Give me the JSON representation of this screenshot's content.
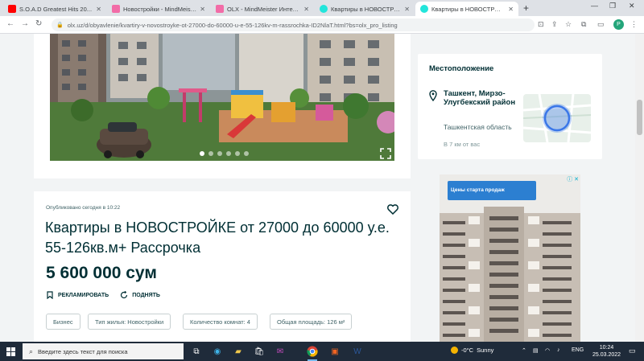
{
  "browser": {
    "tabs": [
      {
        "favicon": "youtube-icon",
        "title": "S.O.A.D Greatest Hits 20..."
      },
      {
        "favicon": "mindmeister-icon",
        "title": "Новостройки - MindMeister"
      },
      {
        "favicon": "mindmeister-icon",
        "title": "OLX - MindMeister Интелле..."
      },
      {
        "favicon": "olx-icon",
        "title": "Квартиры в НОВОСТРОЙКЕ..."
      },
      {
        "favicon": "olx-icon",
        "title": "Квартиры в НОВОСТРОЙКЕ..."
      }
    ],
    "active_tab": 4,
    "new_tab_label": "+",
    "url": "olx.uz/d/obyavlenie/kvartiry-v-novostroyke-ot-27000-do-60000-u-e-55-126kv-m-rassrochka-ID2NlaT.html?bs=olx_pro_listing",
    "profile_initial": "P"
  },
  "gallery": {
    "photo_count": 6,
    "active_photo": 0
  },
  "location": {
    "title": "Местоположение",
    "city": "Ташкент, Мирзо-Улугбекский район",
    "region": "Ташкентская область",
    "distance": "В 7 км от вас"
  },
  "ad": {
    "banner_text": "Цены старта продаж",
    "choice_label": "ⓘ ✕"
  },
  "listing": {
    "published": "Опубликовано сегодня в 10:22",
    "title": "Квартиры в НОВОСТРОЙКЕ от 27000 до 60000 у.е. 55-126кв.м+ Рассрочка",
    "price": "5 600 000 сум",
    "promote_label": "РЕКЛАМИРОВАТЬ",
    "raise_label": "ПОДНЯТЬ",
    "tags": [
      "Бизнес",
      "Тип жилья: Новостройки",
      "Количество комнат: 4",
      "Общая площадь: 126 м²"
    ]
  },
  "taskbar": {
    "search_placeholder": "Введите здесь текст для поиска",
    "weather_temp": "-0°C",
    "weather_text": "Sunny",
    "language": "ENG",
    "time": "10:24",
    "date": "25.03.2022"
  },
  "colors": {
    "olx_dark": "#002f34",
    "olx_teal": "#23e5db",
    "taskbar": "#1f2b3a"
  }
}
